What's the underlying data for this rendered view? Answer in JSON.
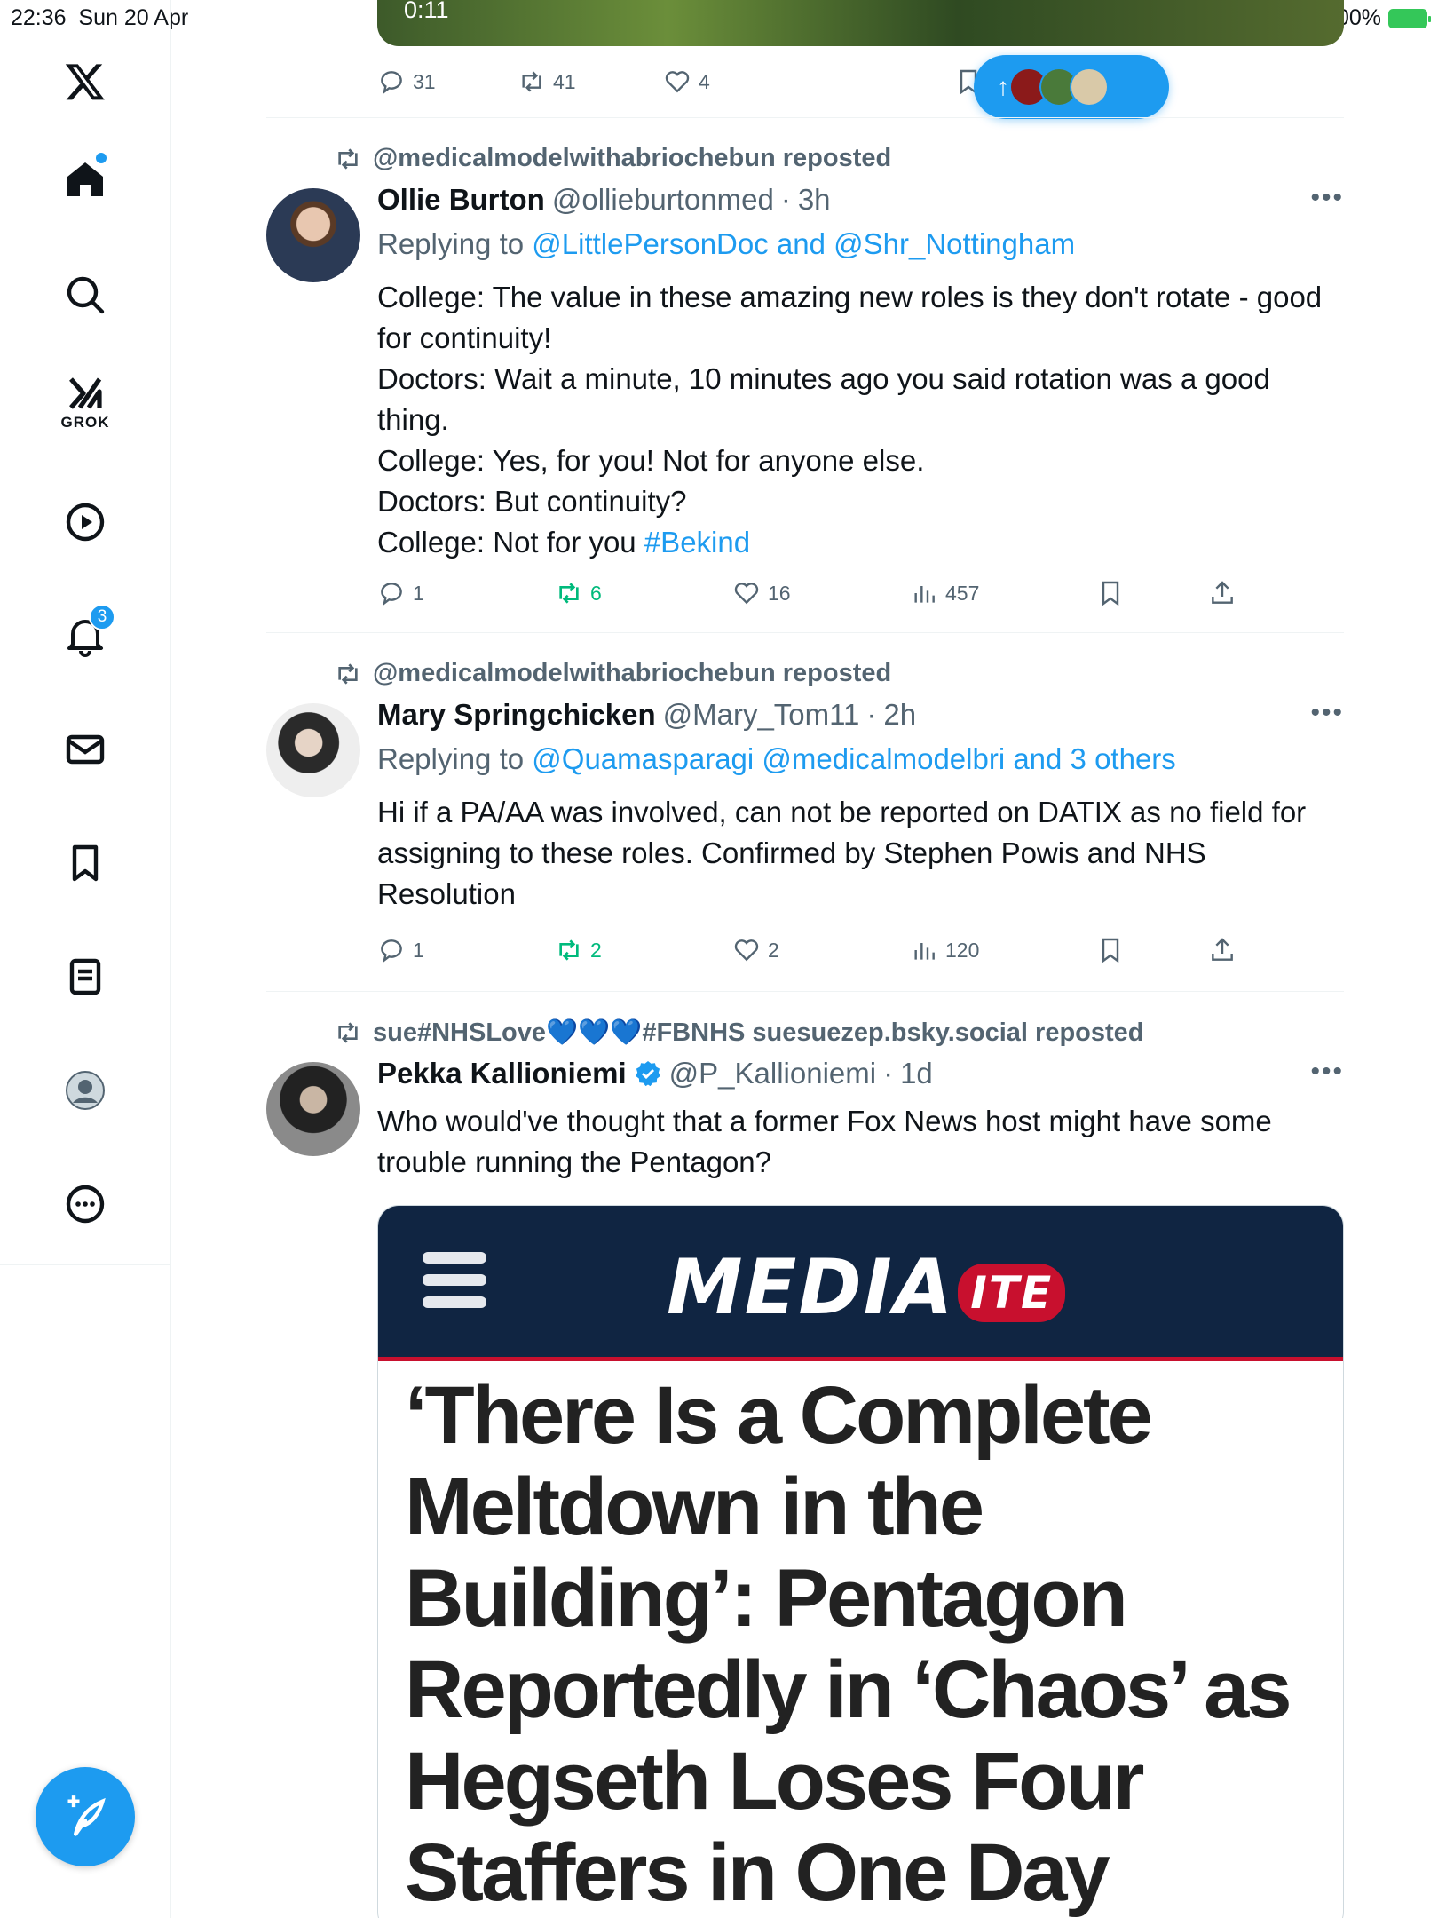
{
  "status_bar": {
    "time": "22:36",
    "date": "Sun 20 Apr",
    "battery": "100%"
  },
  "sidebar": {
    "grok_label": "GROK",
    "notifications_badge": "3",
    "items": [
      "home",
      "explore",
      "grok",
      "videos",
      "notifications",
      "messages",
      "bookmarks",
      "lists",
      "profile",
      "more"
    ]
  },
  "video": {
    "time": "0:11"
  },
  "top_actions": {
    "replies": "31",
    "reposts": "41",
    "likes": "4"
  },
  "tweets": [
    {
      "reposted_by": "@medicalmodelwithabriochebun reposted",
      "name": "Ollie Burton",
      "handle": "@ollieburtonmed",
      "time": "3h",
      "replying_prefix": "Replying to",
      "replying_to": "@LittlePersonDoc and @Shr_Nottingham",
      "lines": [
        "College: The value in these amazing new roles is they don't rotate - good for continuity!",
        "Doctors: Wait a minute, 10 minutes ago you said rotation was a good thing.",
        "College: Yes, for you! Not for anyone else.",
        "Doctors: But continuity?",
        "College: Not for you"
      ],
      "hashtag": "#Bekind",
      "replies": "1",
      "reposts": "6",
      "likes": "16",
      "views": "457"
    },
    {
      "reposted_by": "@medicalmodelwithabriochebun reposted",
      "name": "Mary Springchicken",
      "handle": "@Mary_Tom11",
      "time": "2h",
      "replying_prefix": "Replying to",
      "replying_to": "@Quamasparagi @medicalmodelbri and 3 others",
      "text": "Hi if a PA/AA was involved, can not be reported on DATIX as no field for assigning to these roles. Confirmed by Stephen Powis and NHS Resolution",
      "replies": "1",
      "reposts": "2",
      "likes": "2",
      "views": "120"
    },
    {
      "reposted_by": "sue#NHSLove💙💙💙#FBNHS suesuezep.bsky.social reposted",
      "name": "Pekka Kallioniemi",
      "handle": "@P_Kallioniemi",
      "time": "1d",
      "text": "Who would've thought that a former Fox News host might have some trouble running the Pentagon?",
      "media": {
        "logo_main": "MEDIA",
        "logo_badge": "ITE",
        "headline": "‘There Is a Complete Meltdown in the Building’: Pentagon Reportedly in ‘Chaos’ as Hegseth Loses Four Staffers in One Day"
      }
    }
  ],
  "colors": {
    "accent": "#1d9bf0",
    "repost_green": "#00ba7c",
    "secondary_text": "#536471"
  }
}
